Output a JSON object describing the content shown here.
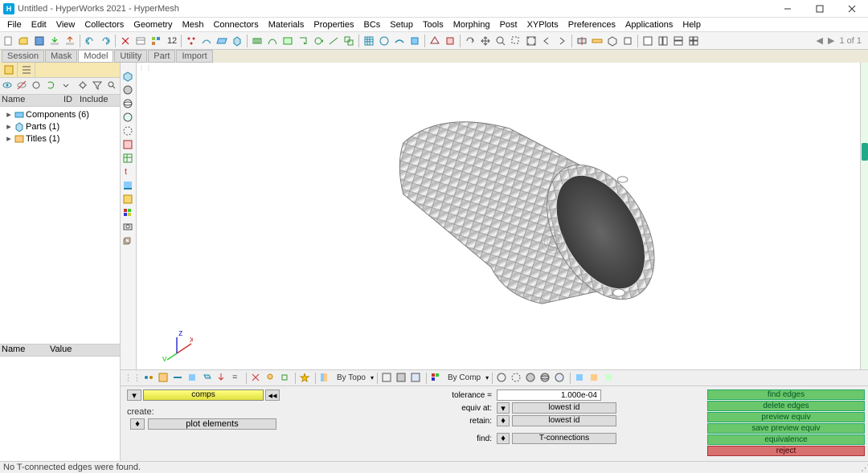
{
  "window": {
    "title": "Untitled - HyperWorks 2021 - HyperMesh"
  },
  "menubar": [
    "File",
    "Edit",
    "View",
    "Collectors",
    "Geometry",
    "Mesh",
    "Connectors",
    "Materials",
    "Properties",
    "BCs",
    "Setup",
    "Tools",
    "Morphing",
    "Post",
    "XYPlots",
    "Preferences",
    "Applications",
    "Help"
  ],
  "tabs": [
    "Session",
    "Mask",
    "Model",
    "Utility",
    "Part",
    "Import"
  ],
  "active_tab_idx": 2,
  "page_counter": "1 of 1",
  "tree": {
    "header": {
      "name": "Name",
      "id": "ID",
      "include": "Include"
    },
    "items": [
      {
        "icon": "comp",
        "label": "Components (6)"
      },
      {
        "icon": "part",
        "label": "Parts (1)"
      },
      {
        "icon": "title",
        "label": "Titles (1)"
      }
    ]
  },
  "props_header": {
    "name": "Name",
    "value": "Value"
  },
  "viewport_toolbar": {
    "bytopo": "By Topo",
    "bycomp": "By Comp"
  },
  "panel": {
    "comps_label": "comps",
    "create_label": "create:",
    "plot_elements": "plot elements",
    "tolerance_label": "tolerance =",
    "tolerance_value": "1.000e-04",
    "equiv_label": "equiv at:",
    "retain_label": "retain:",
    "find_label": "find:",
    "lowest_id": "lowest id",
    "tconn": "T-connections",
    "actions": [
      "find edges",
      "delete edges",
      "preview equiv",
      "save preview equiv",
      "equivalence",
      "reject"
    ]
  },
  "status": "No T-connected edges were found."
}
